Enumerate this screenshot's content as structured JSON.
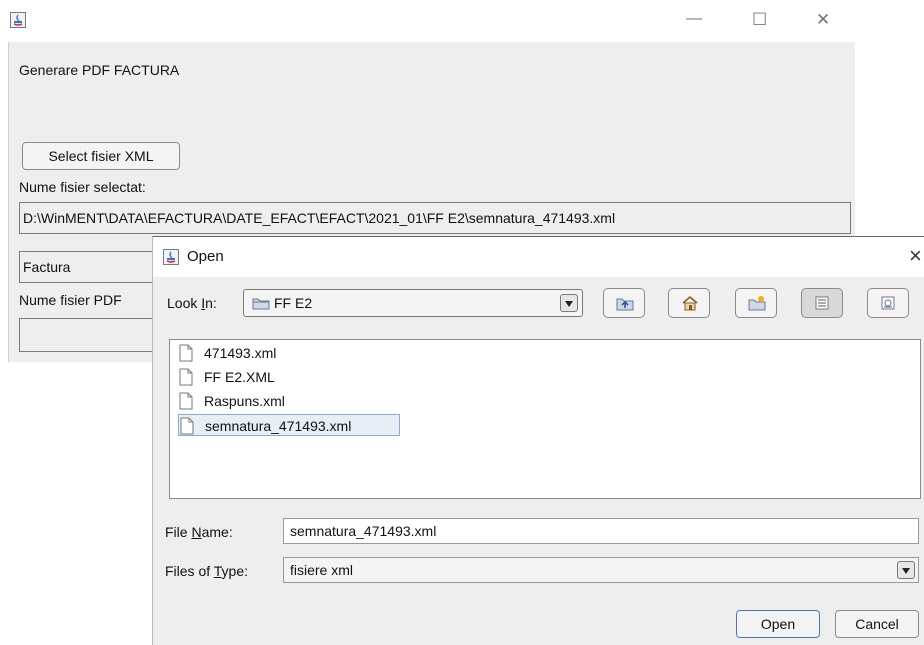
{
  "main_window": {
    "heading": "Generare PDF FACTURA",
    "select_button": "Select fisier XML",
    "selected_label": "Nume fisier selectat:",
    "selected_path": "D:\\WinMENT\\DATA\\EFACTURA\\DATE_EFACT\\EFACT\\2021_01\\FF E2\\semnatura_471493.xml",
    "factura_field": "Factura",
    "pdf_label_visible": "Nume fisier PDF",
    "pdf_field": "",
    "controls": {
      "minimize": "—",
      "maximize": "☐",
      "close": "✕"
    }
  },
  "dialog": {
    "title": "Open",
    "close": "×",
    "look_in": {
      "label_prefix": "Look ",
      "label_mnemonic": "I",
      "label_suffix": "n:",
      "value": "FF E2"
    },
    "toolbar": [
      "up-one-level-icon",
      "home-icon",
      "new-folder-icon",
      "list-view-icon",
      "details-view-icon"
    ],
    "files": [
      {
        "name": "471493.xml",
        "selected": false
      },
      {
        "name": "FF E2.XML",
        "selected": false
      },
      {
        "name": "Raspuns.xml",
        "selected": false
      },
      {
        "name": "semnatura_471493.xml",
        "selected": true
      }
    ],
    "file_name": {
      "label_prefix": "File ",
      "label_mnemonic": "N",
      "label_suffix": "ame:",
      "value": "semnatura_471493.xml"
    },
    "file_type": {
      "label_prefix": "Files of ",
      "label_mnemonic": "T",
      "label_suffix": "ype:",
      "value": "fisiere xml"
    },
    "open_button": "Open",
    "cancel_button": "Cancel"
  },
  "colors": {
    "window_bg": "#eeeeee",
    "selection_border": "#8fa9c8",
    "accent_blue": "#4a78c0"
  }
}
